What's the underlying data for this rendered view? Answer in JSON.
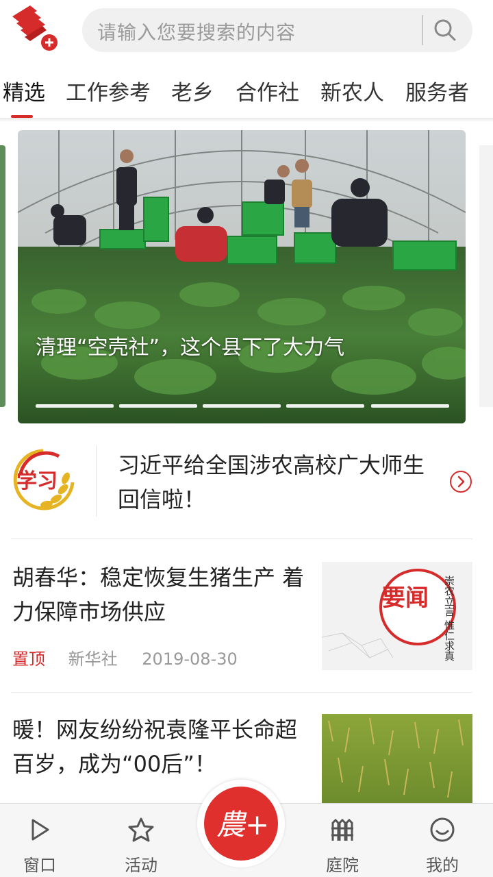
{
  "search": {
    "placeholder": "请输入您要搜索的内容"
  },
  "tabs": [
    {
      "label": "精选",
      "active": true
    },
    {
      "label": "工作参考"
    },
    {
      "label": "老乡"
    },
    {
      "label": "合作社"
    },
    {
      "label": "新农人"
    },
    {
      "label": "服务者"
    }
  ],
  "carousel": {
    "caption": "清理“空壳社”，这个县下了大力气",
    "slide_count": 5,
    "active_index": 0
  },
  "study": {
    "logo_text": "学习",
    "headline": "习近平给全国涉农高校广大师生回信啦！"
  },
  "articles": [
    {
      "title": "胡春华：稳定恢复生猪生产 着力保障市场供应",
      "pinned_label": "置顶",
      "source": "新华社",
      "date": "2019-08-30",
      "thumb_text": "要闻",
      "thumb_vertical": "崇农立言 惟仁求真"
    },
    {
      "title": "暖！网友纷纷祝袁隆平长命超百岁，成为“00后”！"
    }
  ],
  "bottom_nav": {
    "items": [
      {
        "label": "窗口",
        "icon": "play-icon"
      },
      {
        "label": "活动",
        "icon": "star-icon"
      },
      {
        "label": "庭院",
        "icon": "fence-icon"
      },
      {
        "label": "我的",
        "icon": "smile-icon"
      }
    ],
    "center_label": "農+"
  },
  "colors": {
    "accent": "#d52b2b",
    "center_button": "#e0302d"
  }
}
